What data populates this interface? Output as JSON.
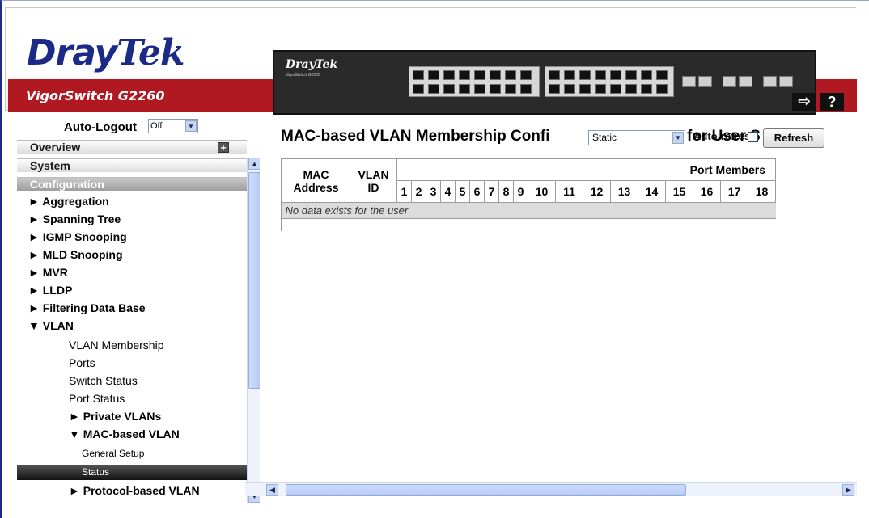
{
  "header": {
    "logo_dray": "Dray",
    "logo_tek": "Tek",
    "model": "VigorSwitch G2260",
    "device_logo": "DrayTek",
    "device_sub": "VigorSwitch G2260",
    "help_label": "?"
  },
  "auto_logout": {
    "label": "Auto-Logout",
    "value": "Off"
  },
  "menu": {
    "overview": "Overview",
    "system": "System",
    "configuration": "Configuration",
    "items": [
      "► Aggregation",
      "► Spanning Tree",
      "► IGMP Snooping",
      "► MLD Snooping",
      "► MVR",
      "► LLDP",
      "► Filtering Data Base",
      "▼ VLAN"
    ],
    "vlan_children": [
      "VLAN Membership",
      "Ports",
      "Switch Status",
      "Port Status"
    ],
    "private_vlans": "► Private VLANs",
    "mac_based_vlan": "▼ MAC-based VLAN",
    "mac_children": [
      "General Setup",
      "Status"
    ],
    "protocol_based_vlan": "► Protocol-based VLAN"
  },
  "main": {
    "title": "MAC-based VLAN Membership Confi",
    "user_select": "Static",
    "title_tail": "for User S",
    "title_tail_end": "a",
    "auto_refresh_label": "Auto-refresh",
    "refresh_button": "Refresh"
  },
  "table": {
    "col_mac": "MAC Address",
    "col_vlan": "VLAN ID",
    "port_members_header": "Port Members",
    "ports": [
      "1",
      "2",
      "3",
      "4",
      "5",
      "6",
      "7",
      "8",
      "9",
      "10",
      "11",
      "12",
      "13",
      "14",
      "15",
      "16",
      "17",
      "18"
    ],
    "empty_message": "No data exists for the user"
  },
  "colors": {
    "brand_blue": "#1b2a86",
    "brand_red": "#b01822",
    "selected_bg": "#111111"
  }
}
